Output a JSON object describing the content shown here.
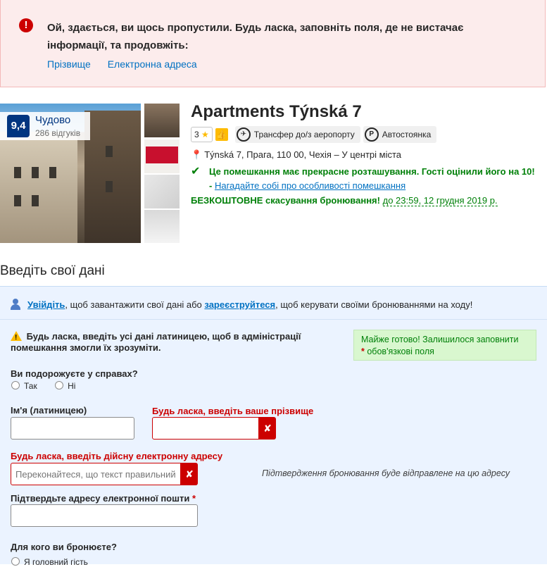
{
  "error_banner": {
    "message": "Ой, здається, ви щось пропустили. Будь ласка, заповніть поля, де не вистачає інформації, та продовжіть:",
    "links": [
      "Прізвище",
      "Електронна адреса"
    ]
  },
  "hotel": {
    "score": "9,4",
    "score_word": "Чудово",
    "review_count": "286 відгуків",
    "name": "Apartments Týnská 7",
    "stars": "3",
    "badges": {
      "transfer": "Трансфер до/з аеропорту",
      "parking": "Автостоянка",
      "parking_icon_letter": "P"
    },
    "address": "Týnská 7, Прага, 110 00, Чехія – У центрі міста",
    "location_note": "Це помешкання має прекрасне розташування. Гості оцінили його на 10! - ",
    "location_link": "Нагадайте собі про особливості помешкання",
    "free_cancel": "БЕЗКОШТОВНЕ скасування бронювання!",
    "free_cancel_deadline": "до 23:59, 12 грудня 2019 р."
  },
  "form": {
    "section_title": "Введіть свої дані",
    "login": {
      "signin_link": "Увійдіть",
      "mid_text": ", щоб завантажити свої дані або ",
      "register_link": "зареєструйтеся",
      "end_text": ", щоб керувати своїми бронюваннями на ходу!"
    },
    "latin_warning": "Будь ласка, введіть усі дані латиницею, щоб в адміністрації помешкання змогли їх зрозуміти.",
    "almost_done": "Майже готово! Залишилося заповнити",
    "almost_done_req": "обов'язкові поля",
    "business_q": "Ви подорожуєте у справах?",
    "business_opts": [
      "Так",
      "Ні"
    ],
    "first_name_label": "Ім'я (латиницею)",
    "first_name_value": "",
    "last_name_error": "Будь ласка, введіть ваше прізвище",
    "last_name_value": "",
    "email_error": "Будь ласка, введіть дійсну електронну адресу",
    "email_placeholder": "Переконайтеся, що текст правильний",
    "email_note": "Підтвердження бронювання буде відправлене на цю адресу",
    "confirm_email_label": "Підтвердьте адресу електронної пошти",
    "confirm_email_value": "",
    "who_q": "Для кого ви бронюєте?",
    "who_opt1": "Я головний гість"
  },
  "colors": {
    "brand_blue": "#003580",
    "link": "#0071c2",
    "error": "#cc0000",
    "success": "#008009"
  }
}
